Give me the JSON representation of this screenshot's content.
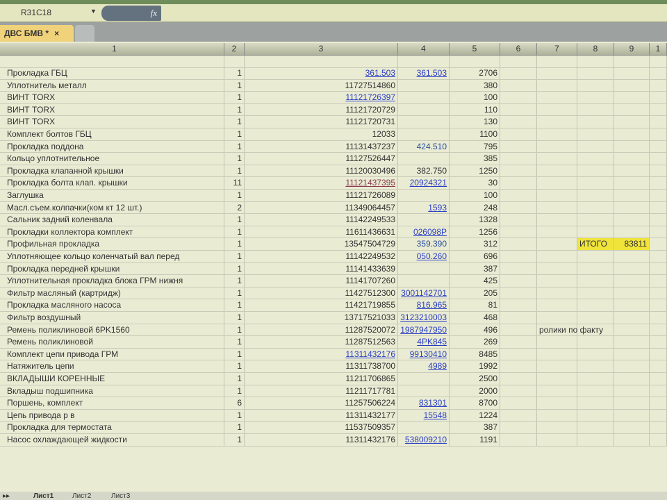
{
  "formula_bar": {
    "cell_ref": "R31C18",
    "fx": "fx"
  },
  "document_tab": {
    "title": "ДВС БМВ *",
    "close": "×"
  },
  "columns": [
    "1",
    "2",
    "3",
    "4",
    "5",
    "6",
    "7",
    "8",
    "9",
    "1"
  ],
  "rows": [
    [
      "Прокладка ГБЦ",
      "1",
      "361.503",
      "361.503",
      "2706",
      "link",
      "link"
    ],
    [
      "Уплотнитель металл",
      "1",
      "11727514860",
      "",
      "380",
      "",
      ""
    ],
    [
      "ВИНТ TORX",
      "1",
      "11121726397",
      "",
      "100",
      "link",
      ""
    ],
    [
      "ВИНТ TORX",
      "1",
      "11121720729",
      "",
      "110",
      "",
      ""
    ],
    [
      "ВИНТ TORX",
      "1",
      "11121720731",
      "",
      "130",
      "",
      ""
    ],
    [
      "Комплект болтов ГБЦ",
      "1",
      "12033",
      "",
      "1100",
      "",
      ""
    ],
    [
      "Прокладка поддона",
      "1",
      "11131437237",
      "424.510",
      "795",
      "",
      "blue"
    ],
    [
      "Кольцо уплотнительное",
      "1",
      "11127526447",
      "",
      "385",
      "",
      ""
    ],
    [
      "Прокладка клапанной крышки",
      "1",
      "11120030496",
      "382.750",
      "1250",
      "",
      ""
    ],
    [
      "Прокладка болта клап. крышки",
      "11",
      "11121437395",
      "20924321",
      "30",
      "visited",
      "link"
    ],
    [
      "Заглушка",
      "1",
      "11121726089",
      "",
      "100",
      "",
      ""
    ],
    [
      "Масл.съем.колпачки(ком кт 12 шт.)",
      "2",
      "11349064457",
      "1593",
      "248",
      "",
      "link"
    ],
    [
      "Сальник задний коленвала",
      "1",
      "11142249533",
      "",
      "1328",
      "",
      ""
    ],
    [
      "Прокладки коллектора комплект",
      "1",
      "11611436631",
      "026098P",
      "1256",
      "",
      "link"
    ],
    [
      "Профильная прокладка",
      "1",
      "13547504729",
      "359.390",
      "312",
      "",
      "blue"
    ],
    [
      "Уплотняющее кольцо коленчатый вал перед",
      "1",
      "11142249532",
      "050.260",
      "696",
      "",
      "link"
    ],
    [
      "Прокладка передней крышки",
      "1",
      "11141433639",
      "",
      "387",
      "",
      ""
    ],
    [
      "Уплотнительная прокладка блока ГРМ нижня",
      "1",
      "11141707260",
      "",
      "425",
      "",
      ""
    ],
    [
      "Фильтр масляный (картридж)",
      "1",
      "11427512300",
      "3001142701",
      "205",
      "",
      "link"
    ],
    [
      "Прокладка масляного насоса",
      "1",
      "11421719855",
      "816.965",
      "81",
      "",
      "link"
    ],
    [
      "Фильтр воздушный",
      "1",
      "13717521033",
      "3123210003",
      "468",
      "",
      "link"
    ],
    [
      "Ремень поликлиновой 6PK1560",
      "1",
      "11287520072",
      "1987947950",
      "496",
      "",
      "link"
    ],
    [
      "Ремень поликлиновой",
      "1",
      "11287512563",
      "4PK845",
      "269",
      "",
      "link"
    ],
    [
      "Комплект цепи привода ГРМ",
      "1",
      "11311432176",
      "99130410",
      "8485",
      "link",
      "link"
    ],
    [
      "Натяжитель цепи",
      "1",
      "11311738700",
      "4989",
      "1992",
      "",
      "link"
    ],
    [
      "ВКЛАДЫШИ КОРЕННЫЕ",
      "1",
      "11211706865",
      "",
      "2500",
      "",
      ""
    ],
    [
      "Вкладыш подшипника",
      "1",
      "11211717781",
      "",
      "2000",
      "",
      ""
    ],
    [
      "Поршень, комплект",
      "6",
      "11257506224",
      "831301",
      "8700",
      "",
      "link"
    ],
    [
      "Цепь привода р в",
      "1",
      "11311432177",
      "15548",
      "1224",
      "",
      "link"
    ],
    [
      "Прокладка для термостата",
      "1",
      "11537509357",
      "",
      "387",
      "",
      ""
    ],
    [
      "Насос охлаждающей жидкости",
      "1",
      "11311432176",
      "538009210",
      "1191",
      "",
      "link"
    ]
  ],
  "total": {
    "label": "ИТОГО",
    "value": "83811"
  },
  "note": "ролики по факту",
  "sheets": [
    "Лист1",
    "Лист2",
    "Лист3"
  ],
  "colors": {
    "highlight": "#f0e43a",
    "link": "#2b3fc4"
  }
}
